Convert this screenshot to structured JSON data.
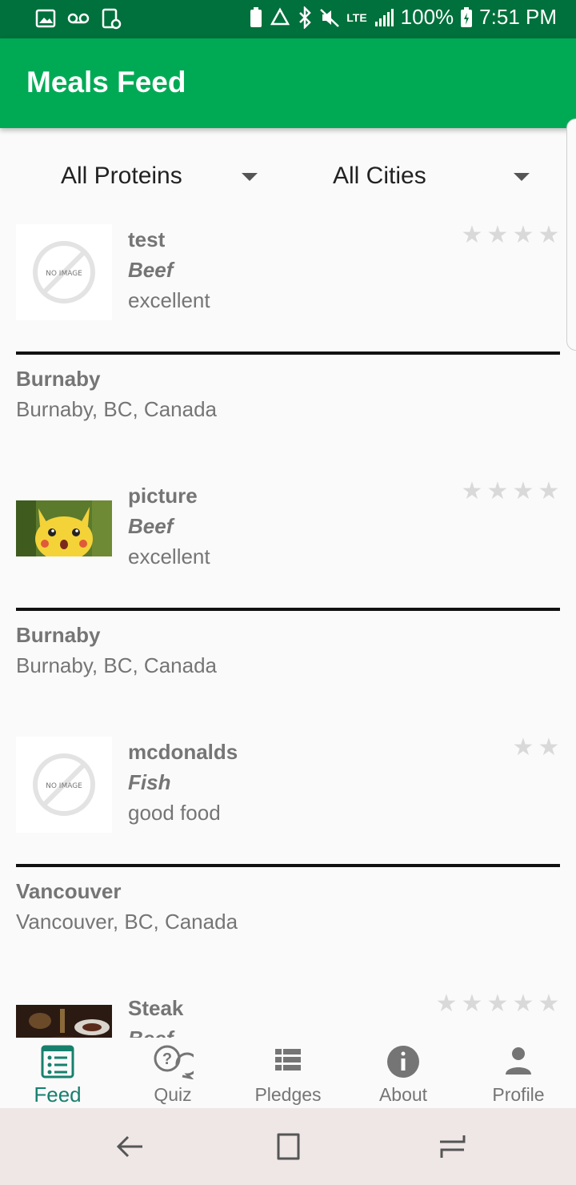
{
  "status_bar": {
    "battery": "100%",
    "time": "7:51 PM",
    "network": "LTE"
  },
  "app_bar": {
    "title": "Meals Feed"
  },
  "filters": {
    "protein": {
      "selected": "All Proteins"
    },
    "city": {
      "selected": "All Cities"
    }
  },
  "feed": {
    "items": [
      {
        "name": "test",
        "protein": "Beef",
        "description": "excellent",
        "city": "Burnaby",
        "address": "Burnaby, BC, Canada",
        "stars": 4,
        "image": "no-image",
        "no_image_text": "NO IMAGE"
      },
      {
        "name": "picture",
        "protein": "Beef",
        "description": "excellent",
        "city": "Burnaby",
        "address": "Burnaby, BC, Canada",
        "stars": 4,
        "image": "pikachu-photo"
      },
      {
        "name": "mcdonalds",
        "protein": "Fish",
        "description": "good food",
        "city": "Vancouver",
        "address": "Vancouver, BC, Canada",
        "stars": 2,
        "image": "no-image",
        "no_image_text": "NO IMAGE"
      },
      {
        "name": "Steak",
        "protein": "Beef",
        "stars": 5,
        "image": "steak-photo"
      }
    ]
  },
  "bottom_nav": {
    "items": [
      {
        "label": "Feed",
        "icon": "feed-icon",
        "active": true
      },
      {
        "label": "Quiz",
        "icon": "quiz-icon"
      },
      {
        "label": "Pledges",
        "icon": "list-icon"
      },
      {
        "label": "About",
        "icon": "info-icon"
      },
      {
        "label": "Profile",
        "icon": "person-icon"
      }
    ]
  },
  "colors": {
    "status_bar": "#00703c",
    "app_bar": "#00aa55",
    "active_tab": "#16806d",
    "text_secondary": "#757575",
    "star": "#d9d9d9"
  }
}
